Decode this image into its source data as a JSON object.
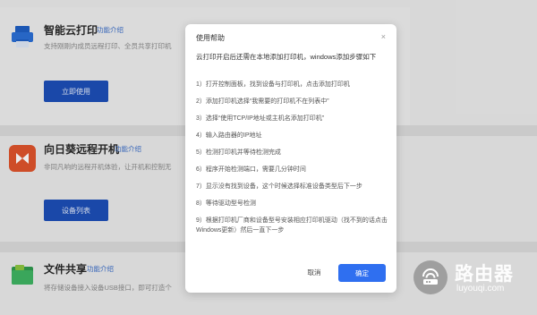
{
  "features": [
    {
      "title": "智能云打印",
      "link": "功能介绍",
      "desc": "支持刚刚内成员远程打印、全员共享打印机",
      "button": "立即使用",
      "icon": "printer-icon",
      "color": "#2b6fd6"
    },
    {
      "title": "向日葵远程开机",
      "link": "功能介绍",
      "desc": "非同凡响的远程开机体验，让开机和控制无",
      "button": "设备列表",
      "icon": "sunlogin-icon",
      "color": "#e0542c"
    },
    {
      "title": "文件共享",
      "link": "功能介绍",
      "desc": "将存储设备接入设备USB接口，即可打造个",
      "button": "",
      "icon": "folder-icon",
      "color": "#2e9a4e"
    }
  ],
  "modal": {
    "title": "使用帮助",
    "close": "×",
    "intro": "云打印开启后还需在本地添加打印机，windows添加步骤如下",
    "steps": [
      "1）打开控制面板，找到设备与打印机，点击添加打印机",
      "2）添加打印机选择“我需要的打印机不在列表中”",
      "3）选择“使用TCP/IP地址或主机名添加打印机”",
      "4）输入路由器的IP地址",
      "5）检测打印机并等待检测完成",
      "6）程序开始检测端口，需要几分钟时间",
      "7）显示没有找到设备，这个时候选择标准设备类型后下一步",
      "8）等待驱动型号检测",
      "9）根据打印机厂商和设备型号安装相应打印机驱动（找不到的话点击Windows更新）然后一直下一步"
    ],
    "cancel": "取消",
    "ok": "确定"
  },
  "watermark": {
    "name": "路由器",
    "url": "luyouqi.com"
  }
}
